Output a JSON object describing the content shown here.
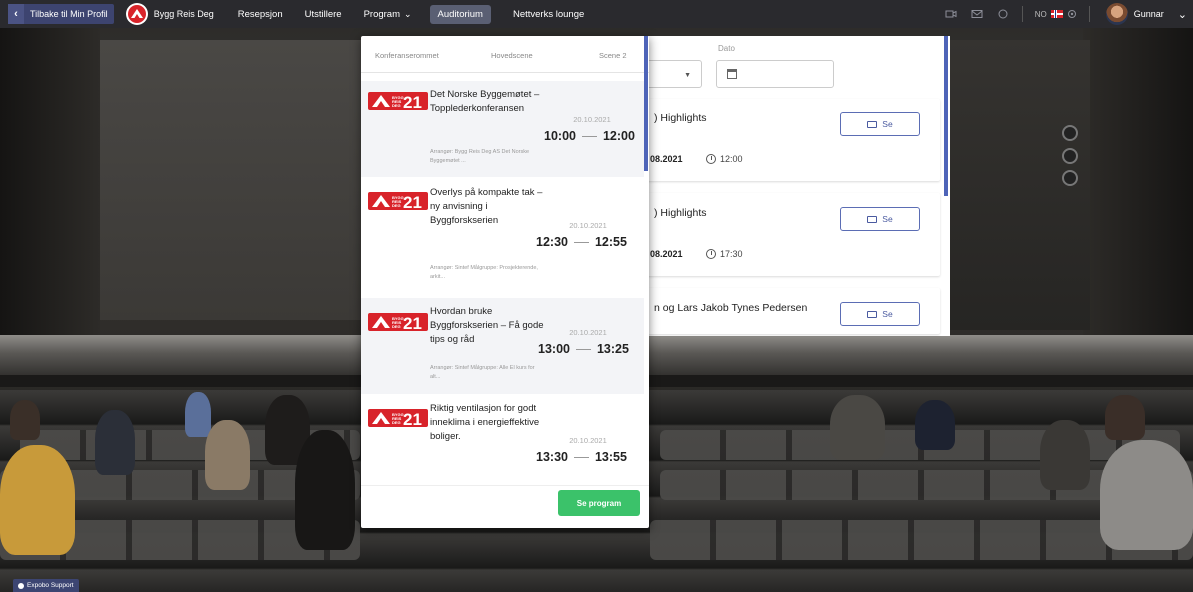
{
  "topbar": {
    "back_label": "Tilbake til Min Profil",
    "brand_name": "Bygg Reis Deg",
    "nav": [
      {
        "label": "Resepsjon"
      },
      {
        "label": "Utstillere"
      },
      {
        "label": "Program"
      },
      {
        "label": "Auditorium"
      },
      {
        "label": "Nettverks lounge"
      }
    ],
    "active_nav": "Auditorium",
    "language": "NO",
    "user_name": "Gunnar",
    "icons": [
      "camera-icon",
      "mail-icon",
      "bell-icon",
      "settings-icon",
      "chevron-down-icon"
    ]
  },
  "dropdown": {
    "tabs": [
      "Konferanserommet",
      "Hovedscene",
      "Scene 2"
    ],
    "logo_text": {
      "small": "BYGG REIS DEG",
      "big": "21"
    },
    "sessions": [
      {
        "title": "Det Norske Byggemøtet – Topplederkonferansen",
        "date": "20.10.2021",
        "start": "10:00",
        "end": "12:00",
        "organizer": "Arrangør: Bygg Reis Deg AS Det Norske Byggemøtet ..."
      },
      {
        "title": "Overlys på kompakte tak – ny anvisning i Byggforskserien",
        "date": "20.10.2021",
        "start": "12:30",
        "end": "12:55",
        "organizer": "Arrangør: Sintef Målgruppe: Prosjekterende, arkit..."
      },
      {
        "title": "Hvordan bruke Byggforskserien – Få gode tips og råd",
        "date": "20.10.2021",
        "start": "13:00",
        "end": "13:25",
        "organizer": "Arrangør: Sintef Målgruppe: Alle El kurs for alt..."
      },
      {
        "title": "Riktig ventilasjon for godt inneklima i energieffektive boliger.",
        "date": "20.10.2021",
        "start": "13:30",
        "end": "13:55",
        "organizer": ""
      }
    ],
    "cta": "Se program"
  },
  "program_panel": {
    "date_label": "Dato",
    "cards": [
      {
        "title": ") Highlights",
        "date": "08.2021",
        "time": "12:00",
        "button": "Se"
      },
      {
        "title": ") Highlights",
        "date": "08.2021",
        "time": "17:30",
        "button": "Se"
      },
      {
        "title": "n og Lars Jakob Tynes Pedersen",
        "date": "",
        "time": "",
        "button": "Se"
      }
    ]
  },
  "support": {
    "label": "Expobo Support"
  },
  "colors": {
    "topbar": "#2a2a2e",
    "accent_blue": "#4e64b8",
    "cta_green": "#3bc26a",
    "brand_red": "#d8232a"
  }
}
